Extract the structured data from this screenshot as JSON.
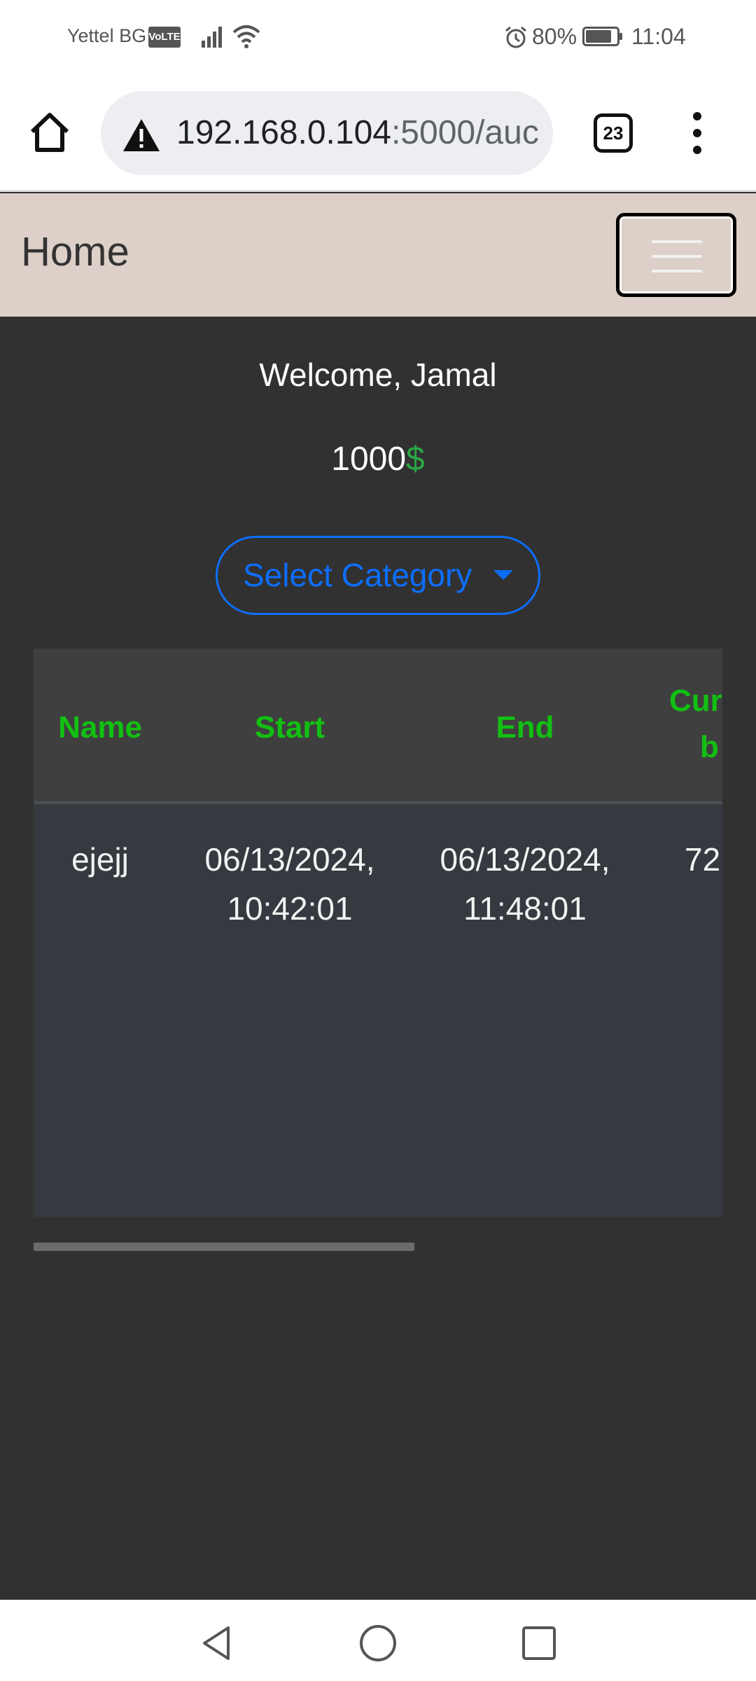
{
  "status_bar": {
    "carrier": "Yettel BG",
    "volte": "VoLTE",
    "battery_percent": "80%",
    "time": "11:04"
  },
  "browser": {
    "url_host": "192.168.0.104",
    "url_rest": ":5000/auc",
    "tab_count": "23"
  },
  "navbar": {
    "title": "Home"
  },
  "main": {
    "welcome": "Welcome, Jamal",
    "balance_amount": "1000",
    "balance_currency": "$",
    "category_button": "Select Category"
  },
  "table": {
    "headers": [
      "Name",
      "Start",
      "End",
      "Cur",
      "b"
    ],
    "rows": [
      {
        "name": "ejejj",
        "start_date": "06/13/2024,",
        "start_time": "10:42:01",
        "end_date": "06/13/2024,",
        "end_time": "11:48:01",
        "current_bid": "72"
      }
    ]
  },
  "colors": {
    "navbar_bg": "#dcd0c8",
    "page_bg": "#313131",
    "header_text": "#12c012",
    "accent_blue": "#0d6efd",
    "currency_green": "#28a745"
  }
}
